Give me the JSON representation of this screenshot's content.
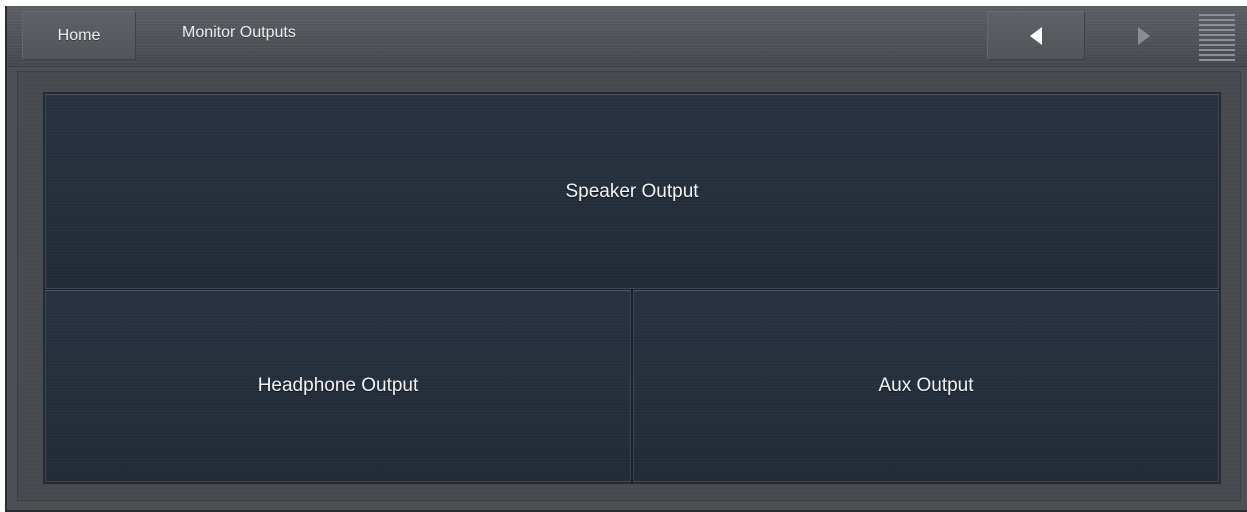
{
  "toolbar": {
    "home_label": "Home",
    "title": "Monitor Outputs",
    "back_icon": "left-triangle-icon",
    "forward_icon": "right-triangle-icon",
    "menu_icon": "hamburger-menu-icon"
  },
  "outputs": [
    {
      "label": "Speaker Output"
    },
    {
      "label": "Headphone Output"
    },
    {
      "label": "Aux Output"
    }
  ],
  "colors": {
    "toolbar_bg": "#52565a",
    "tile_bg": "#252d3a",
    "text": "#f2f4f6",
    "forward_icon_disabled": "#8a8e92"
  }
}
